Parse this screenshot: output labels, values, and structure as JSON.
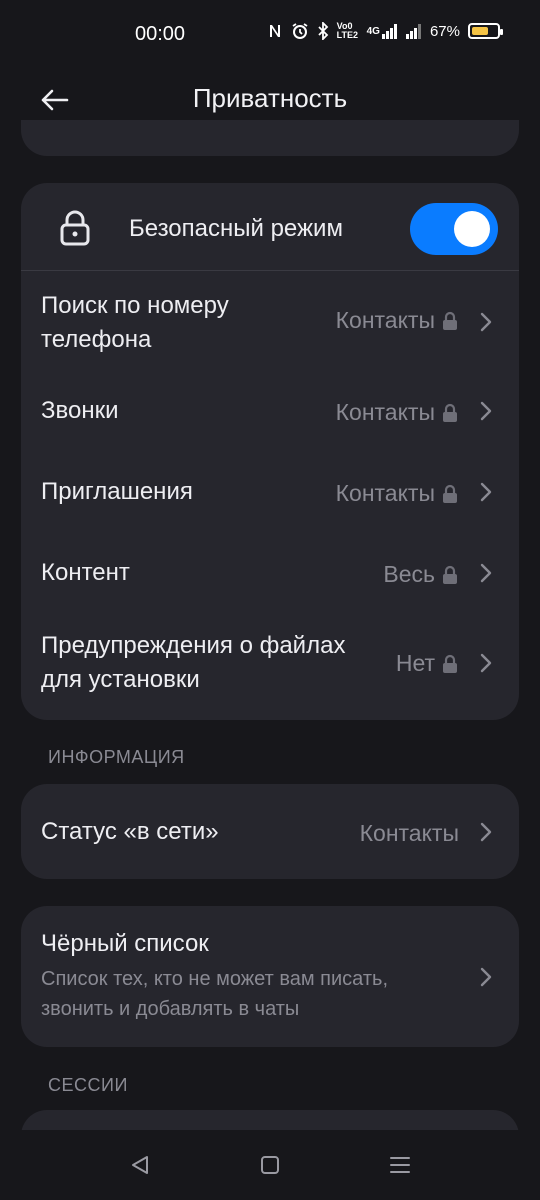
{
  "status": {
    "time": "00:00",
    "battery": "67%",
    "battery_fraction": 0.67,
    "lte": "Vo0 LTE2",
    "network": "4G"
  },
  "header": {
    "title": "Приватность"
  },
  "safe_mode": {
    "label": "Безопасный режим",
    "enabled": true
  },
  "privacy_rows": [
    {
      "label": "Поиск по номеру телефона",
      "value": "Контакты",
      "locked": true
    },
    {
      "label": "Звонки",
      "value": "Контакты",
      "locked": true
    },
    {
      "label": "Приглашения",
      "value": "Контакты",
      "locked": true
    },
    {
      "label": "Контент",
      "value": "Весь",
      "locked": true
    },
    {
      "label": "Предупреждения о файлах для установки",
      "value": "Нет",
      "locked": true
    }
  ],
  "info_section": {
    "title": "ИНФОРМАЦИЯ"
  },
  "online_status": {
    "label": "Статус «в сети»",
    "value": "Контакты"
  },
  "blacklist": {
    "title": "Чёрный список",
    "subtitle": "Список тех, кто не может вам писать, звонить и добавлять в чаты"
  },
  "sessions_section": {
    "title": "СЕССИИ"
  },
  "colors": {
    "accent": "#0a7cff",
    "card": "#26262d",
    "background": "#17171b",
    "muted": "#8a8a93"
  },
  "icons": [
    "back-arrow-icon",
    "lock-icon",
    "chevron-right-icon",
    "nav-back-icon",
    "nav-home-icon",
    "nav-menu-icon"
  ]
}
